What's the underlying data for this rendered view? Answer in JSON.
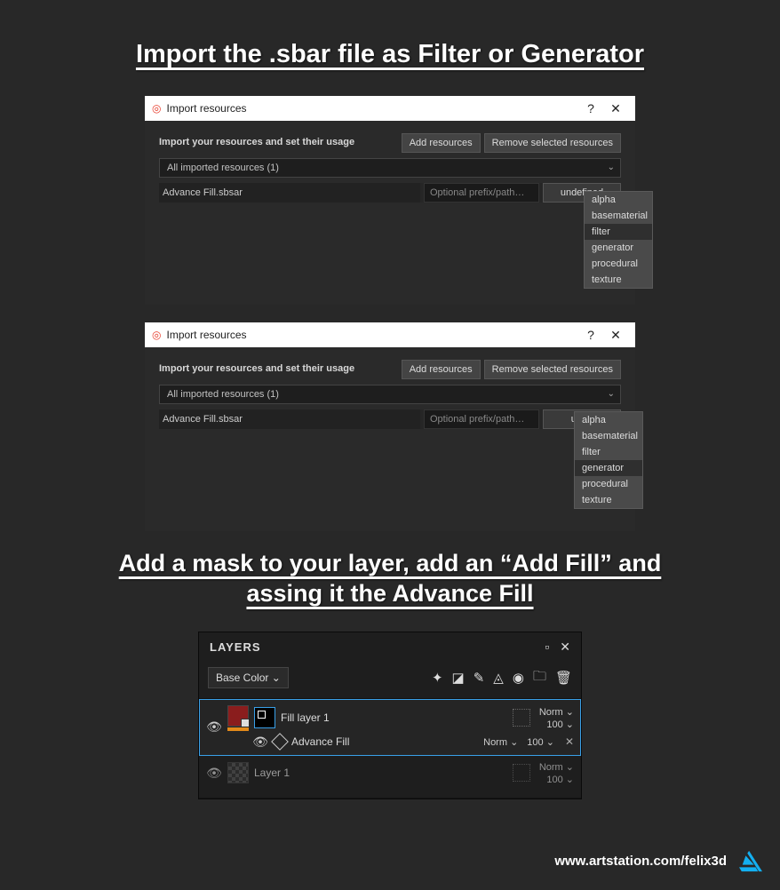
{
  "heading1": "Import the .sbar file as Filter or Generator",
  "heading2": "Add a mask to your layer, add an “Add Fill” and assing it the Advance Fill",
  "dialog": {
    "title": "Import resources",
    "help": "?",
    "close": "✕",
    "instruction": "Import your resources and set their usage",
    "add_btn": "Add resources",
    "remove_btn": "Remove selected resources",
    "select_label": "All imported resources (1)",
    "resource_name": "Advance Fill.sbsar",
    "prefix_placeholder": "Optional prefix/path…",
    "undefined_btn": "undefined",
    "unde_btn": "unde"
  },
  "dropdown": {
    "items": [
      "alpha",
      "basematerial",
      "filter",
      "generator",
      "procedural",
      "texture"
    ]
  },
  "layers": {
    "title": "LAYERS",
    "channel": "Base Color",
    "fill_layer": "Fill layer 1",
    "advance_fill": "Advance Fill",
    "layer1": "Layer 1",
    "norm": "Norm",
    "p100": "100"
  },
  "footer": {
    "url": "www.artstation.com/felix3d"
  }
}
